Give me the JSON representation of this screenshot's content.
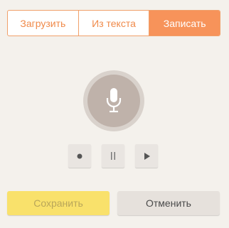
{
  "tabs": [
    {
      "label": "Загрузить",
      "active": false
    },
    {
      "label": "Из текста",
      "active": false
    },
    {
      "label": "Записать",
      "active": true
    }
  ],
  "recorder": {
    "mic_icon": "microphone-icon",
    "controls": [
      {
        "name": "record-button",
        "icon": "record-dot-icon"
      },
      {
        "name": "pause-button",
        "icon": "pause-icon"
      },
      {
        "name": "play-button",
        "icon": "play-icon"
      }
    ]
  },
  "actions": {
    "save_label": "Сохранить",
    "cancel_label": "Отменить"
  },
  "colors": {
    "accent": "#f7935a",
    "background": "#f4f1ec",
    "save_button": "#f9e16b",
    "cancel_button": "#e6e1dc"
  }
}
